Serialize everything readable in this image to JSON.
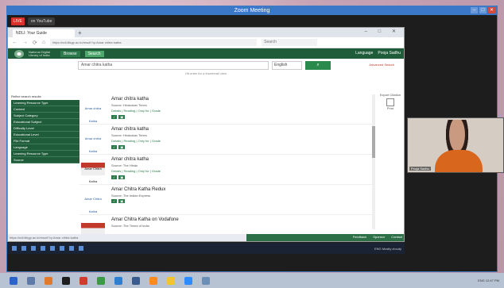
{
  "zoom": {
    "title": "Zoom Meeting",
    "live_label": "LIVE",
    "youtube_label": "on YouTube"
  },
  "browser": {
    "tab_title": "NDLI: Your Guide",
    "url": "https://ndl.iitkgp.ac.in/result?q=Amar chitra katha",
    "search_placeholder": "Search"
  },
  "site": {
    "logo_text": "National Digital Library of India",
    "browse_label": "Browse",
    "search_label": "Search",
    "language_label": "Language",
    "user_label": "Pooja Sadhu",
    "query": "Amar chitra katha",
    "language_value": "English",
    "advanced_label": "Advanced Search",
    "hint": "Hit enter for a thumbnail view"
  },
  "sidebar": {
    "heading": "Refine search results",
    "items": [
      "Learning Resource Type",
      "Content",
      "Subject Category",
      "Educational Subject",
      "Difficulty Level",
      "Educational Level",
      "File Format",
      "Language",
      "Learning Resource Type",
      "Source"
    ]
  },
  "results": [
    {
      "title": "Amar chitra katha",
      "thumb": "Amar chitra Katha",
      "source": "Source: Hindustan Times",
      "links": "Details | Reading | Only for | Grade"
    },
    {
      "title": "Amar chitra katha",
      "thumb": "Amar chitra Katha",
      "source": "Source: Hindustan Times",
      "links": "Details | Reading | Only for | Grade"
    },
    {
      "title": "Amar chitra katha",
      "thumb": "Amar Chitra Katha",
      "source": "Source: The Hindu",
      "links": "Details | Reading | Only for | Grade"
    },
    {
      "title": "Amar Chitra Katha Redux",
      "thumb": "Amar Chitra Katha",
      "source": "Source: The Indian Express",
      "links": ""
    },
    {
      "title": "Amar Chitra Katha on Vodafone",
      "thumb": "",
      "source": "Source: The Times of India",
      "links": ""
    }
  ],
  "right_panel": {
    "label": "Export Citation",
    "icon_label": "Print"
  },
  "statusbar": {
    "url": "https://ndl.iitkgp.ac.in/result?q=Amar chitra katha",
    "feedback": "Feedback",
    "sponsor": "Sponsor",
    "contact": "Contact"
  },
  "cam": {
    "name": "Pooja Sadhu"
  },
  "inner_taskbar": {
    "tray": "ENG  Mostly cloudy"
  },
  "outer_taskbar": {
    "tray": "ENG  12:47 PM"
  }
}
